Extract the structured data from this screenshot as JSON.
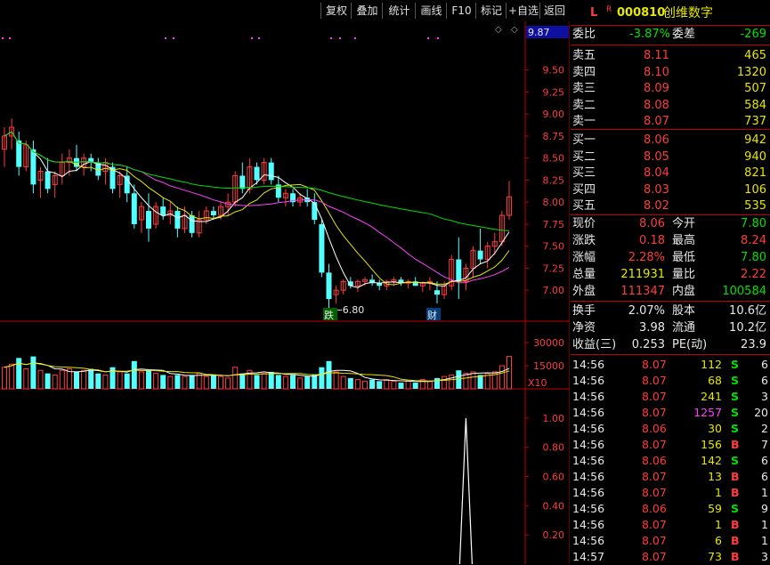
{
  "toolbar": {
    "items": [
      "复权",
      "叠加",
      "统计",
      "画线",
      "F10",
      "标记",
      "+自选",
      "返回"
    ]
  },
  "chart": {
    "price_axis": [
      "9.50",
      "9.25",
      "9.00",
      "8.75",
      "8.50",
      "8.25",
      "8.00",
      "7.75",
      "7.50",
      "7.25",
      "7.00"
    ],
    "price_top_label": "9.87",
    "volume_axis": [
      "30000",
      "15000"
    ],
    "volume_unit": "X10",
    "indicator_axis": [
      "1.00",
      "0.80",
      "0.60",
      "0.40",
      "0.20"
    ],
    "low_annotation": "6.80",
    "marker_die": "跌",
    "marker_cai": "财"
  },
  "chart_data": {
    "type": "candlestick",
    "ylim": [
      6.8,
      9.85
    ],
    "candles": [
      [
        8.6,
        8.85,
        8.4,
        8.75
      ],
      [
        8.75,
        8.95,
        8.6,
        8.85
      ],
      [
        8.7,
        8.8,
        8.3,
        8.4
      ],
      [
        8.4,
        8.7,
        8.35,
        8.65
      ],
      [
        8.6,
        8.7,
        8.1,
        8.2
      ],
      [
        8.25,
        8.4,
        8.05,
        8.35
      ],
      [
        8.35,
        8.5,
        8.1,
        8.15
      ],
      [
        8.2,
        8.35,
        8.05,
        8.3
      ],
      [
        8.3,
        8.55,
        8.2,
        8.45
      ],
      [
        8.45,
        8.6,
        8.3,
        8.5
      ],
      [
        8.5,
        8.65,
        8.35,
        8.4
      ],
      [
        8.4,
        8.55,
        8.3,
        8.5
      ],
      [
        8.5,
        8.55,
        8.35,
        8.45
      ],
      [
        8.45,
        8.5,
        8.25,
        8.3
      ],
      [
        8.35,
        8.5,
        8.2,
        8.45
      ],
      [
        8.4,
        8.45,
        8.1,
        8.15
      ],
      [
        8.2,
        8.35,
        8.05,
        8.3
      ],
      [
        8.3,
        8.4,
        8.0,
        8.1
      ],
      [
        8.1,
        8.2,
        7.7,
        7.75
      ],
      [
        7.8,
        8.0,
        7.65,
        7.95
      ],
      [
        7.9,
        8.1,
        7.55,
        7.7
      ],
      [
        7.75,
        8.0,
        7.7,
        7.95
      ],
      [
        7.95,
        8.05,
        7.8,
        7.85
      ],
      [
        7.85,
        8.0,
        7.75,
        7.9
      ],
      [
        7.9,
        7.95,
        7.6,
        7.7
      ],
      [
        7.7,
        7.95,
        7.65,
        7.85
      ],
      [
        7.85,
        7.9,
        7.6,
        7.65
      ],
      [
        7.65,
        7.9,
        7.6,
        7.8
      ],
      [
        7.8,
        7.95,
        7.75,
        7.9
      ],
      [
        7.9,
        7.95,
        7.8,
        7.85
      ],
      [
        7.85,
        8.0,
        7.8,
        7.95
      ],
      [
        7.95,
        8.1,
        7.85,
        8.0
      ],
      [
        8.0,
        8.35,
        7.95,
        8.3
      ],
      [
        8.3,
        8.45,
        8.1,
        8.15
      ],
      [
        8.15,
        8.5,
        8.1,
        8.4
      ],
      [
        8.4,
        8.45,
        8.2,
        8.25
      ],
      [
        8.25,
        8.5,
        8.2,
        8.45
      ],
      [
        8.45,
        8.5,
        8.2,
        8.25
      ],
      [
        8.2,
        8.3,
        8.0,
        8.05
      ],
      [
        8.05,
        8.15,
        7.95,
        8.1
      ],
      [
        8.1,
        8.15,
        7.95,
        8.0
      ],
      [
        8.0,
        8.1,
        7.95,
        8.05
      ],
      [
        8.05,
        8.15,
        7.95,
        8.0
      ],
      [
        8.0,
        8.1,
        7.75,
        7.8
      ],
      [
        7.75,
        7.8,
        7.15,
        7.2
      ],
      [
        7.2,
        7.3,
        6.8,
        6.9
      ],
      [
        6.95,
        7.05,
        6.85,
        7.0
      ],
      [
        7.0,
        7.12,
        6.95,
        7.1
      ],
      [
        7.1,
        7.15,
        7.02,
        7.05
      ],
      [
        7.05,
        7.12,
        6.98,
        7.1
      ],
      [
        7.1,
        7.15,
        7.05,
        7.12
      ],
      [
        7.12,
        7.18,
        7.05,
        7.08
      ],
      [
        7.08,
        7.12,
        7.0,
        7.05
      ],
      [
        7.05,
        7.12,
        7.0,
        7.1
      ],
      [
        7.1,
        7.15,
        7.05,
        7.12
      ],
      [
        7.12,
        7.15,
        7.05,
        7.08
      ],
      [
        7.08,
        7.12,
        7.02,
        7.1
      ],
      [
        7.1,
        7.15,
        7.05,
        7.05
      ],
      [
        7.05,
        7.1,
        6.98,
        7.08
      ],
      [
        7.08,
        7.15,
        7.0,
        7.1
      ],
      [
        7.0,
        7.1,
        6.85,
        6.95
      ],
      [
        6.95,
        7.1,
        6.9,
        7.05
      ],
      [
        7.05,
        7.4,
        7.0,
        7.35
      ],
      [
        7.35,
        7.6,
        6.9,
        7.1
      ],
      [
        7.1,
        7.3,
        7.0,
        7.25
      ],
      [
        7.25,
        7.5,
        7.15,
        7.45
      ],
      [
        7.45,
        7.7,
        7.3,
        7.35
      ],
      [
        7.35,
        7.55,
        7.25,
        7.5
      ],
      [
        7.5,
        7.65,
        7.4,
        7.55
      ],
      [
        7.55,
        7.9,
        7.5,
        7.85
      ],
      [
        7.85,
        8.24,
        7.8,
        8.06
      ]
    ],
    "volumes": [
      14000,
      16000,
      20000,
      13000,
      21000,
      12000,
      10000,
      9000,
      12000,
      13000,
      11000,
      12000,
      13000,
      10000,
      9000,
      14000,
      11000,
      10000,
      18000,
      11000,
      12000,
      10000,
      9000,
      8000,
      9000,
      8000,
      9000,
      10000,
      8000,
      9000,
      8000,
      7000,
      14000,
      10000,
      12000,
      9000,
      10000,
      11000,
      9000,
      8000,
      9000,
      7000,
      8000,
      9000,
      14000,
      18000,
      11000,
      8000,
      7000,
      6000,
      5000,
      6000,
      5000,
      6000,
      5000,
      4000,
      5000,
      4000,
      6000,
      5000,
      7000,
      8000,
      9000,
      12000,
      10000,
      11000,
      9000,
      10000,
      11000,
      15000,
      21000
    ],
    "indicator_peak_index": 64,
    "indicator_peak_value": 1.0
  },
  "quote": {
    "code": "000810",
    "name": "创维数字",
    "flag_l": "L",
    "flag_r": "R",
    "weibi_label": "委比",
    "weibi_value": "-3.87%",
    "weicha_label": "委差",
    "weicha_value": "-269",
    "asks": [
      {
        "label": "卖五",
        "price": "8.11",
        "vol": "465"
      },
      {
        "label": "卖四",
        "price": "8.10",
        "vol": "1320"
      },
      {
        "label": "卖三",
        "price": "8.09",
        "vol": "507"
      },
      {
        "label": "卖二",
        "price": "8.08",
        "vol": "584"
      },
      {
        "label": "卖一",
        "price": "8.07",
        "vol": "737"
      }
    ],
    "bids": [
      {
        "label": "买一",
        "price": "8.06",
        "vol": "942"
      },
      {
        "label": "买二",
        "price": "8.05",
        "vol": "940"
      },
      {
        "label": "买三",
        "price": "8.04",
        "vol": "821"
      },
      {
        "label": "买四",
        "price": "8.03",
        "vol": "106"
      },
      {
        "label": "买五",
        "price": "8.02",
        "vol": "535"
      }
    ],
    "stats": [
      {
        "l1": "现价",
        "v1": "8.06",
        "c1": "red",
        "l2": "今开",
        "v2": "7.80",
        "c2": "green"
      },
      {
        "l1": "涨跌",
        "v1": "0.18",
        "c1": "red",
        "l2": "最高",
        "v2": "8.24",
        "c2": "red"
      },
      {
        "l1": "涨幅",
        "v1": "2.28%",
        "c1": "red",
        "l2": "最低",
        "v2": "7.80",
        "c2": "green"
      },
      {
        "l1": "总量",
        "v1": "211931",
        "c1": "yellow",
        "l2": "量比",
        "v2": "2.22",
        "c2": "red"
      },
      {
        "l1": "外盘",
        "v1": "111347",
        "c1": "red",
        "l2": "内盘",
        "v2": "100584",
        "c2": "green"
      }
    ],
    "stats2": [
      {
        "l1": "换手",
        "v1": "2.07%",
        "l2": "股本",
        "v2": "10.6亿"
      },
      {
        "l1": "净资",
        "v1": "3.98",
        "l2": "流通",
        "v2": "10.2亿"
      },
      {
        "l1": "收益(三)",
        "v1": "0.253",
        "l2": "PE(动)",
        "v2": "23.9"
      }
    ],
    "ticks": [
      {
        "time": "14:56",
        "price": "8.07",
        "pc": "red",
        "vol": "112",
        "vc": "yellow",
        "side": "S",
        "sc": "green",
        "n": "6"
      },
      {
        "time": "14:56",
        "price": "8.07",
        "pc": "red",
        "vol": "68",
        "vc": "yellow",
        "side": "S",
        "sc": "green",
        "n": "6"
      },
      {
        "time": "14:56",
        "price": "8.07",
        "pc": "red",
        "vol": "241",
        "vc": "yellow",
        "side": "S",
        "sc": "green",
        "n": "3"
      },
      {
        "time": "14:56",
        "price": "8.07",
        "pc": "red",
        "vol": "1257",
        "vc": "magenta",
        "side": "S",
        "sc": "green",
        "n": "20"
      },
      {
        "time": "14:56",
        "price": "8.06",
        "pc": "red",
        "vol": "30",
        "vc": "yellow",
        "side": "S",
        "sc": "green",
        "n": "2"
      },
      {
        "time": "14:56",
        "price": "8.07",
        "pc": "red",
        "vol": "156",
        "vc": "yellow",
        "side": "B",
        "sc": "red",
        "n": "7"
      },
      {
        "time": "14:56",
        "price": "8.06",
        "pc": "red",
        "vol": "142",
        "vc": "yellow",
        "side": "S",
        "sc": "green",
        "n": "6"
      },
      {
        "time": "14:56",
        "price": "8.07",
        "pc": "red",
        "vol": "13",
        "vc": "yellow",
        "side": "B",
        "sc": "red",
        "n": "6"
      },
      {
        "time": "14:56",
        "price": "8.07",
        "pc": "red",
        "vol": "1",
        "vc": "yellow",
        "side": "B",
        "sc": "red",
        "n": "1"
      },
      {
        "time": "14:56",
        "price": "8.06",
        "pc": "red",
        "vol": "59",
        "vc": "yellow",
        "side": "S",
        "sc": "green",
        "n": "9"
      },
      {
        "time": "14:56",
        "price": "8.07",
        "pc": "red",
        "vol": "1",
        "vc": "yellow",
        "side": "B",
        "sc": "red",
        "n": "1"
      },
      {
        "time": "14:56",
        "price": "8.07",
        "pc": "red",
        "vol": "6",
        "vc": "yellow",
        "side": "B",
        "sc": "red",
        "n": "1"
      },
      {
        "time": "14:57",
        "price": "8.07",
        "pc": "red",
        "vol": "73",
        "vc": "yellow",
        "side": "B",
        "sc": "red",
        "n": "3"
      }
    ],
    "colors": {
      "up": "#ff3c3c",
      "down": "#54ffff",
      "border": "#c00000"
    }
  }
}
